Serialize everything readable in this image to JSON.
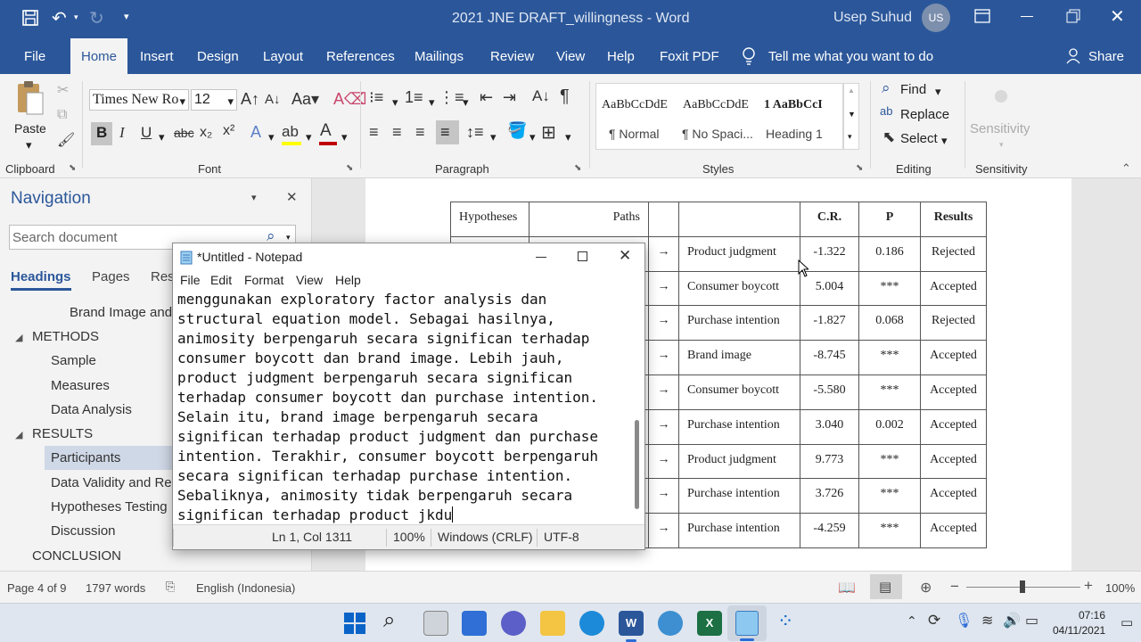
{
  "window": {
    "title": "2021 JNE DRAFT_willingness  -  Word",
    "user_name": "Usep Suhud",
    "user_initials": "US"
  },
  "tabs": [
    "File",
    "Home",
    "Insert",
    "Design",
    "Layout",
    "References",
    "Mailings",
    "Review",
    "View",
    "Help",
    "Foxit PDF"
  ],
  "active_tab": "Home",
  "tell_me": "Tell me what you want to do",
  "share": "Share",
  "ribbon": {
    "clipboard": {
      "paste": "Paste",
      "label": "Clipboard"
    },
    "font": {
      "name": "Times New Ro",
      "size": "12",
      "label": "Font"
    },
    "paragraph": {
      "label": "Paragraph"
    },
    "styles": {
      "preview_text": "AaBbCcDdE",
      "preview_heading": "1  AaBbCcI",
      "items": [
        "¶ Normal",
        "¶ No Spaci...",
        "Heading 1"
      ],
      "label": "Styles"
    },
    "editing": {
      "find": "Find",
      "replace": "Replace",
      "select": "Select",
      "label": "Editing"
    },
    "sensitivity": {
      "button": "Sensitivity",
      "label": "Sensitivity"
    }
  },
  "navigation": {
    "title": "Navigation",
    "search_placeholder": "Search document",
    "tabs": [
      "Headings",
      "Pages",
      "Res"
    ],
    "items": [
      {
        "label": "Brand Image and",
        "level": 3
      },
      {
        "label": "METHODS",
        "level": 1,
        "expanded": true
      },
      {
        "label": "Sample",
        "level": 2
      },
      {
        "label": "Measures",
        "level": 2
      },
      {
        "label": "Data Analysis",
        "level": 2
      },
      {
        "label": "RESULTS",
        "level": 1,
        "expanded": true
      },
      {
        "label": "Participants",
        "level": 2,
        "selected": true
      },
      {
        "label": "Data Validity and Re",
        "level": 2
      },
      {
        "label": "Hypotheses Testing",
        "level": 2
      },
      {
        "label": "Discussion",
        "level": 2
      },
      {
        "label": "CONCLUSION",
        "level": 1
      }
    ]
  },
  "doc_table": {
    "headers": [
      "Hypotheses",
      "Paths",
      "",
      "",
      "C.R.",
      "P",
      "Results"
    ],
    "rows": [
      [
        "",
        "",
        "→",
        "Product judgment",
        "-1.322",
        "0.186",
        "Rejected"
      ],
      [
        "",
        "",
        "→",
        "Consumer boycott",
        "5.004",
        "***",
        "Accepted"
      ],
      [
        "",
        "",
        "→",
        "Purchase intention",
        "-1.827",
        "0.068",
        "Rejected"
      ],
      [
        "",
        "",
        "→",
        "Brand image",
        "-8.745",
        "***",
        "Accepted"
      ],
      [
        "",
        "",
        "→",
        "Consumer boycott",
        "-5.580",
        "***",
        "Accepted"
      ],
      [
        "",
        "",
        "→",
        "Purchase intention",
        "3.040",
        "0.002",
        "Accepted"
      ],
      [
        "",
        "",
        "→",
        "Product judgment",
        "9.773",
        "***",
        "Accepted"
      ],
      [
        "",
        "",
        "→",
        "Purchase intention",
        "3.726",
        "***",
        "Accepted"
      ],
      [
        "",
        "",
        "→",
        "Purchase intention",
        "-4.259",
        "***",
        "Accepted"
      ]
    ]
  },
  "notepad": {
    "title": "*Untitled - Notepad",
    "menu": [
      "File",
      "Edit",
      "Format",
      "View",
      "Help"
    ],
    "lines": [
      "menggunakan exploratory factor analysis dan",
      "structural equation model. Sebagai hasilnya,",
      "animosity berpengaruh secara significan terhadap",
      "consumer boycott dan brand image. Lebih jauh,",
      "product judgment berpengaruh secara significan",
      "terhadap consumer boycott dan purchase intention.",
      "Selain itu, brand image berpengaruh secara",
      "significan terhadap product judgment dan purchase",
      "intention. Terakhir, consumer boycott berpengaruh",
      "secara significan terhadap purchase intention.",
      "Sebaliknya, animosity tidak berpengaruh secara",
      "significan terhadap product jkdu"
    ],
    "status": {
      "position": "Ln 1, Col 1311",
      "zoom": "100%",
      "line_endings": "Windows (CRLF)",
      "encoding": "UTF-8"
    }
  },
  "statusbar": {
    "page": "Page 4 of 9",
    "words": "1797 words",
    "language": "English (Indonesia)",
    "zoom": "100%"
  },
  "clock": {
    "time": "07:16",
    "date": "04/11/2021"
  },
  "colors": {
    "word_blue": "#2b579a",
    "selected_nav": "#cfd8e6"
  }
}
